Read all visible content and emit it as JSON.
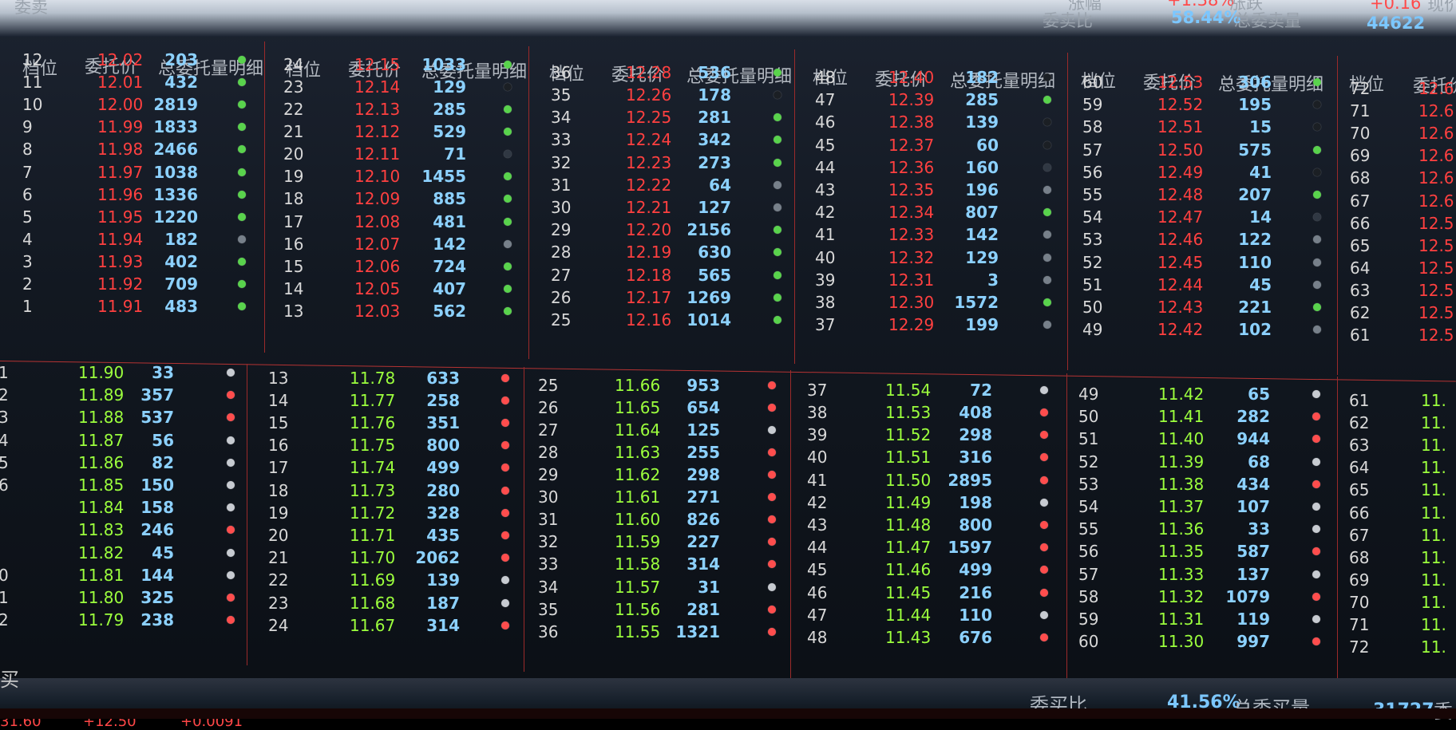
{
  "top": {
    "top_left_label": "委卖",
    "small_label_1": "涨幅",
    "small_value_1": "+1.38%",
    "small_label_2": "涨跌",
    "small_value_2": "+0.16",
    "small_label_3": "现价",
    "ask_ratio_label": "委卖比",
    "ask_ratio_value": "58.44%",
    "ask_total_label": "总委卖量",
    "ask_total_value": "44622"
  },
  "headers": {
    "level": "档位",
    "price": "委托价",
    "detail": "总委托量明细"
  },
  "asks": {
    "col1": [
      {
        "level": "12",
        "price": "12.02",
        "volume": "203",
        "dot": "#59d34c"
      },
      {
        "level": "11",
        "price": "12.01",
        "volume": "432",
        "dot": "#59d34c"
      },
      {
        "level": "10",
        "price": "12.00",
        "volume": "2819",
        "dot": "#59d34c"
      },
      {
        "level": "9",
        "price": "11.99",
        "volume": "1833",
        "dot": "#59d34c"
      },
      {
        "level": "8",
        "price": "11.98",
        "volume": "2466",
        "dot": "#59d34c"
      },
      {
        "level": "7",
        "price": "11.97",
        "volume": "1038",
        "dot": "#59d34c"
      },
      {
        "level": "6",
        "price": "11.96",
        "volume": "1336",
        "dot": "#59d34c"
      },
      {
        "level": "5",
        "price": "11.95",
        "volume": "1220",
        "dot": "#59d34c"
      },
      {
        "level": "4",
        "price": "11.94",
        "volume": "182",
        "dot": "#77808a"
      },
      {
        "level": "3",
        "price": "11.93",
        "volume": "402",
        "dot": "#59d34c"
      },
      {
        "level": "2",
        "price": "11.92",
        "volume": "709",
        "dot": "#59d34c"
      },
      {
        "level": "1",
        "price": "11.91",
        "volume": "483",
        "dot": "#59d34c"
      }
    ],
    "col2": [
      {
        "level": "24",
        "price": "12.15",
        "volume": "1033",
        "dot": "#59d34c"
      },
      {
        "level": "23",
        "price": "12.14",
        "volume": "129",
        "dot": "#1b1f24"
      },
      {
        "level": "22",
        "price": "12.13",
        "volume": "285",
        "dot": "#59d34c"
      },
      {
        "level": "21",
        "price": "12.12",
        "volume": "529",
        "dot": "#59d34c"
      },
      {
        "level": "20",
        "price": "12.11",
        "volume": "71",
        "dot": "#303843"
      },
      {
        "level": "19",
        "price": "12.10",
        "volume": "1455",
        "dot": "#59d34c"
      },
      {
        "level": "18",
        "price": "12.09",
        "volume": "885",
        "dot": "#59d34c"
      },
      {
        "level": "17",
        "price": "12.08",
        "volume": "481",
        "dot": "#59d34c"
      },
      {
        "level": "16",
        "price": "12.07",
        "volume": "142",
        "dot": "#77808a"
      },
      {
        "level": "15",
        "price": "12.06",
        "volume": "724",
        "dot": "#59d34c"
      },
      {
        "level": "14",
        "price": "12.05",
        "volume": "407",
        "dot": "#59d34c"
      },
      {
        "level": "13",
        "price": "12.03",
        "volume": "562",
        "dot": "#59d34c"
      }
    ],
    "col3": [
      {
        "level": "36",
        "price": "12.28",
        "volume": "536",
        "dot": "#59d34c"
      },
      {
        "level": "35",
        "price": "12.26",
        "volume": "178",
        "dot": "#1b1f24"
      },
      {
        "level": "34",
        "price": "12.25",
        "volume": "281",
        "dot": "#59d34c"
      },
      {
        "level": "33",
        "price": "12.24",
        "volume": "342",
        "dot": "#59d34c"
      },
      {
        "level": "32",
        "price": "12.23",
        "volume": "273",
        "dot": "#59d34c"
      },
      {
        "level": "31",
        "price": "12.22",
        "volume": "64",
        "dot": "#77808a"
      },
      {
        "level": "30",
        "price": "12.21",
        "volume": "127",
        "dot": "#77808a"
      },
      {
        "level": "29",
        "price": "12.20",
        "volume": "2156",
        "dot": "#59d34c"
      },
      {
        "level": "28",
        "price": "12.19",
        "volume": "630",
        "dot": "#59d34c"
      },
      {
        "level": "27",
        "price": "12.18",
        "volume": "565",
        "dot": "#59d34c"
      },
      {
        "level": "26",
        "price": "12.17",
        "volume": "1269",
        "dot": "#59d34c"
      },
      {
        "level": "25",
        "price": "12.16",
        "volume": "1014",
        "dot": "#59d34c"
      }
    ],
    "col4": [
      {
        "level": "48",
        "price": "12.40",
        "volume": "182",
        "dot": "#1b1f24"
      },
      {
        "level": "47",
        "price": "12.39",
        "volume": "285",
        "dot": "#59d34c"
      },
      {
        "level": "46",
        "price": "12.38",
        "volume": "139",
        "dot": "#1b1f24"
      },
      {
        "level": "45",
        "price": "12.37",
        "volume": "60",
        "dot": "#1b1f24"
      },
      {
        "level": "44",
        "price": "12.36",
        "volume": "160",
        "dot": "#303843"
      },
      {
        "level": "43",
        "price": "12.35",
        "volume": "196",
        "dot": "#77808a"
      },
      {
        "level": "42",
        "price": "12.34",
        "volume": "807",
        "dot": "#59d34c"
      },
      {
        "level": "41",
        "price": "12.33",
        "volume": "142",
        "dot": "#77808a"
      },
      {
        "level": "40",
        "price": "12.32",
        "volume": "129",
        "dot": "#77808a"
      },
      {
        "level": "39",
        "price": "12.31",
        "volume": "3",
        "dot": "#77808a"
      },
      {
        "level": "38",
        "price": "12.30",
        "volume": "1572",
        "dot": "#59d34c"
      },
      {
        "level": "37",
        "price": "12.29",
        "volume": "199",
        "dot": "#77808a"
      }
    ],
    "col5": [
      {
        "level": "60",
        "price": "12.53",
        "volume": "306",
        "dot": "#59d34c"
      },
      {
        "level": "59",
        "price": "12.52",
        "volume": "195",
        "dot": "#1b1f24"
      },
      {
        "level": "58",
        "price": "12.51",
        "volume": "15",
        "dot": "#1b1f24"
      },
      {
        "level": "57",
        "price": "12.50",
        "volume": "575",
        "dot": "#59d34c"
      },
      {
        "level": "56",
        "price": "12.49",
        "volume": "41",
        "dot": "#1b1f24"
      },
      {
        "level": "55",
        "price": "12.48",
        "volume": "207",
        "dot": "#59d34c"
      },
      {
        "level": "54",
        "price": "12.47",
        "volume": "14",
        "dot": "#303843"
      },
      {
        "level": "53",
        "price": "12.46",
        "volume": "122",
        "dot": "#77808a"
      },
      {
        "level": "52",
        "price": "12.45",
        "volume": "110",
        "dot": "#77808a"
      },
      {
        "level": "51",
        "price": "12.44",
        "volume": "45",
        "dot": "#77808a"
      },
      {
        "level": "50",
        "price": "12.43",
        "volume": "221",
        "dot": "#59d34c"
      },
      {
        "level": "49",
        "price": "12.42",
        "volume": "102",
        "dot": "#77808a"
      }
    ],
    "col6": [
      {
        "level": "72",
        "price": "12.6"
      },
      {
        "level": "71",
        "price": "12.6"
      },
      {
        "level": "70",
        "price": "12.6"
      },
      {
        "level": "69",
        "price": "12.6"
      },
      {
        "level": "68",
        "price": "12.6"
      },
      {
        "level": "67",
        "price": "12.6"
      },
      {
        "level": "66",
        "price": "12.5"
      },
      {
        "level": "65",
        "price": "12.5"
      },
      {
        "level": "64",
        "price": "12.5"
      },
      {
        "level": "63",
        "price": "12.5"
      },
      {
        "level": "62",
        "price": "12.5"
      },
      {
        "level": "61",
        "price": "12.5"
      }
    ]
  },
  "bids": {
    "col1": [
      {
        "level": "1",
        "price": "11.90",
        "volume": "33",
        "dot": "#c7cbd1"
      },
      {
        "level": "2",
        "price": "11.89",
        "volume": "357",
        "dot": "#ff4d4d"
      },
      {
        "level": "3",
        "price": "11.88",
        "volume": "537",
        "dot": "#ff4d4d"
      },
      {
        "level": "4",
        "price": "11.87",
        "volume": "56",
        "dot": "#c7cbd1"
      },
      {
        "level": "5",
        "price": "11.86",
        "volume": "82",
        "dot": "#c7cbd1"
      },
      {
        "level": "6",
        "price": "11.85",
        "volume": "150",
        "dot": "#c7cbd1"
      },
      {
        "level": "",
        "price": "11.84",
        "volume": "158",
        "dot": "#c7cbd1"
      },
      {
        "level": "",
        "price": "11.83",
        "volume": "246",
        "dot": "#ff4d4d"
      },
      {
        "level": "",
        "price": "11.82",
        "volume": "45",
        "dot": "#c7cbd1"
      },
      {
        "level": "0",
        "price": "11.81",
        "volume": "144",
        "dot": "#c7cbd1"
      },
      {
        "level": "1",
        "price": "11.80",
        "volume": "325",
        "dot": "#ff4d4d"
      },
      {
        "level": "2",
        "price": "11.79",
        "volume": "238",
        "dot": "#ff4d4d"
      }
    ],
    "col2": [
      {
        "level": "13",
        "price": "11.78",
        "volume": "633",
        "dot": "#ff4d4d"
      },
      {
        "level": "14",
        "price": "11.77",
        "volume": "258",
        "dot": "#ff4d4d"
      },
      {
        "level": "15",
        "price": "11.76",
        "volume": "351",
        "dot": "#ff4d4d"
      },
      {
        "level": "16",
        "price": "11.75",
        "volume": "800",
        "dot": "#ff4d4d"
      },
      {
        "level": "17",
        "price": "11.74",
        "volume": "499",
        "dot": "#ff4d4d"
      },
      {
        "level": "18",
        "price": "11.73",
        "volume": "280",
        "dot": "#ff4d4d"
      },
      {
        "level": "19",
        "price": "11.72",
        "volume": "328",
        "dot": "#ff4d4d"
      },
      {
        "level": "20",
        "price": "11.71",
        "volume": "435",
        "dot": "#ff4d4d"
      },
      {
        "level": "21",
        "price": "11.70",
        "volume": "2062",
        "dot": "#ff4d4d"
      },
      {
        "level": "22",
        "price": "11.69",
        "volume": "139",
        "dot": "#c7cbd1"
      },
      {
        "level": "23",
        "price": "11.68",
        "volume": "187",
        "dot": "#c7cbd1"
      },
      {
        "level": "24",
        "price": "11.67",
        "volume": "314",
        "dot": "#ff4d4d"
      }
    ],
    "col3": [
      {
        "level": "25",
        "price": "11.66",
        "volume": "953",
        "dot": "#ff4d4d"
      },
      {
        "level": "26",
        "price": "11.65",
        "volume": "654",
        "dot": "#ff4d4d"
      },
      {
        "level": "27",
        "price": "11.64",
        "volume": "125",
        "dot": "#c7cbd1"
      },
      {
        "level": "28",
        "price": "11.63",
        "volume": "255",
        "dot": "#ff4d4d"
      },
      {
        "level": "29",
        "price": "11.62",
        "volume": "298",
        "dot": "#ff4d4d"
      },
      {
        "level": "30",
        "price": "11.61",
        "volume": "271",
        "dot": "#ff4d4d"
      },
      {
        "level": "31",
        "price": "11.60",
        "volume": "826",
        "dot": "#ff4d4d"
      },
      {
        "level": "32",
        "price": "11.59",
        "volume": "227",
        "dot": "#ff4d4d"
      },
      {
        "level": "33",
        "price": "11.58",
        "volume": "314",
        "dot": "#ff4d4d"
      },
      {
        "level": "34",
        "price": "11.57",
        "volume": "31",
        "dot": "#c7cbd1"
      },
      {
        "level": "35",
        "price": "11.56",
        "volume": "281",
        "dot": "#ff4d4d"
      },
      {
        "level": "36",
        "price": "11.55",
        "volume": "1321",
        "dot": "#ff4d4d"
      }
    ],
    "col4": [
      {
        "level": "37",
        "price": "11.54",
        "volume": "72",
        "dot": "#c7cbd1"
      },
      {
        "level": "38",
        "price": "11.53",
        "volume": "408",
        "dot": "#ff4d4d"
      },
      {
        "level": "39",
        "price": "11.52",
        "volume": "298",
        "dot": "#ff4d4d"
      },
      {
        "level": "40",
        "price": "11.51",
        "volume": "316",
        "dot": "#ff4d4d"
      },
      {
        "level": "41",
        "price": "11.50",
        "volume": "2895",
        "dot": "#ff4d4d"
      },
      {
        "level": "42",
        "price": "11.49",
        "volume": "198",
        "dot": "#c7cbd1"
      },
      {
        "level": "43",
        "price": "11.48",
        "volume": "800",
        "dot": "#ff4d4d"
      },
      {
        "level": "44",
        "price": "11.47",
        "volume": "1597",
        "dot": "#ff4d4d"
      },
      {
        "level": "45",
        "price": "11.46",
        "volume": "499",
        "dot": "#ff4d4d"
      },
      {
        "level": "46",
        "price": "11.45",
        "volume": "216",
        "dot": "#ff4d4d"
      },
      {
        "level": "47",
        "price": "11.44",
        "volume": "110",
        "dot": "#c7cbd1"
      },
      {
        "level": "48",
        "price": "11.43",
        "volume": "676",
        "dot": "#ff4d4d"
      }
    ],
    "col5": [
      {
        "level": "49",
        "price": "11.42",
        "volume": "65",
        "dot": "#c7cbd1"
      },
      {
        "level": "50",
        "price": "11.41",
        "volume": "282",
        "dot": "#ff4d4d"
      },
      {
        "level": "51",
        "price": "11.40",
        "volume": "944",
        "dot": "#ff4d4d"
      },
      {
        "level": "52",
        "price": "11.39",
        "volume": "68",
        "dot": "#c7cbd1"
      },
      {
        "level": "53",
        "price": "11.38",
        "volume": "434",
        "dot": "#ff4d4d"
      },
      {
        "level": "54",
        "price": "11.37",
        "volume": "107",
        "dot": "#c7cbd1"
      },
      {
        "level": "55",
        "price": "11.36",
        "volume": "33",
        "dot": "#c7cbd1"
      },
      {
        "level": "56",
        "price": "11.35",
        "volume": "587",
        "dot": "#ff4d4d"
      },
      {
        "level": "57",
        "price": "11.33",
        "volume": "137",
        "dot": "#c7cbd1"
      },
      {
        "level": "58",
        "price": "11.32",
        "volume": "1079",
        "dot": "#ff4d4d"
      },
      {
        "level": "59",
        "price": "11.31",
        "volume": "119",
        "dot": "#c7cbd1"
      },
      {
        "level": "60",
        "price": "11.30",
        "volume": "997",
        "dot": "#ff4d4d"
      }
    ],
    "col6": [
      {
        "level": "61",
        "price": "11."
      },
      {
        "level": "62",
        "price": "11."
      },
      {
        "level": "63",
        "price": "11."
      },
      {
        "level": "64",
        "price": "11."
      },
      {
        "level": "65",
        "price": "11."
      },
      {
        "level": "66",
        "price": "11."
      },
      {
        "level": "67",
        "price": "11."
      },
      {
        "level": "68",
        "price": "11."
      },
      {
        "level": "69",
        "price": "11."
      },
      {
        "level": "70",
        "price": "11."
      },
      {
        "level": "71",
        "price": "11."
      },
      {
        "level": "72",
        "price": "11."
      }
    ]
  },
  "bottom": {
    "bid_ratio_label": "委买比",
    "bid_ratio_value": "41.56%",
    "bid_total_label": "总委买量",
    "bid_total_value": "31727",
    "left_partial_label": "买",
    "bottom_right_partial_label": "委",
    "bottom_left_value_1": "31.60",
    "bottom_left_value_2": "+12.50",
    "bottom_left_value_3": "+0.0091"
  },
  "colors": {
    "ask_price": "#ff4040",
    "bid_price": "#9cff3d",
    "volume": "#8cd1ff",
    "level": "#d8d8d8",
    "green_dot": "#59d34c",
    "red_dot": "#ff4d4d",
    "gray_dot": "#77808a",
    "dark_dot": "#1b1f24"
  }
}
